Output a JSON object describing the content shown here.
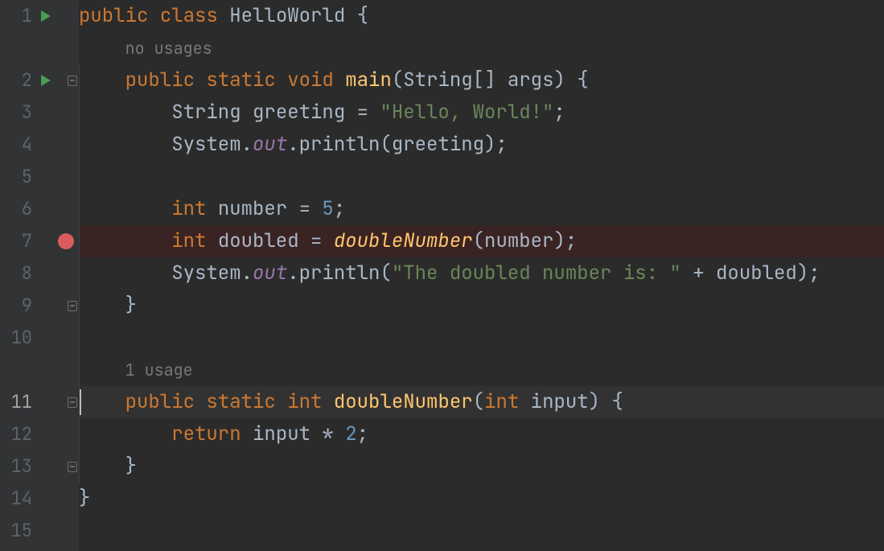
{
  "lines": [
    {
      "num": "1",
      "run": true
    },
    {
      "num": "",
      "inlay": "no usages"
    },
    {
      "num": "2",
      "run": true,
      "foldStart": true
    },
    {
      "num": "3"
    },
    {
      "num": "4"
    },
    {
      "num": "5"
    },
    {
      "num": "6"
    },
    {
      "num": "7",
      "breakpoint": true
    },
    {
      "num": "8"
    },
    {
      "num": "9",
      "foldEnd": true
    },
    {
      "num": "10"
    },
    {
      "num": "",
      "inlay": "1 usage"
    },
    {
      "num": "11",
      "foldStart": true,
      "caretLine": true
    },
    {
      "num": "12"
    },
    {
      "num": "13",
      "foldEnd": true
    },
    {
      "num": "14"
    },
    {
      "num": "15"
    }
  ],
  "inlays": {
    "noUsages": "no usages",
    "oneUsage": "1 usage"
  },
  "code": {
    "kw_public": "public",
    "kw_class": "class",
    "className": "HelloWorld",
    "kw_static": "static",
    "kw_void": "void",
    "mainName": "main",
    "stringArr": "String[]",
    "argsName": "args",
    "stringType": "String",
    "greetingVar": "greeting",
    "helloStr": "\"Hello, World!\"",
    "systemOutPrefix": "System.",
    "outField": "out",
    "printlnName": ".println",
    "kw_int": "int",
    "numberVar": "number",
    "five": "5",
    "doubledVar": "doubled",
    "doubleNumberCall": "doubleNumber",
    "doubledStr": "\"The doubled number is: \"",
    "plus": " + ",
    "doubleNumberDef": "doubleNumber",
    "inputParam": "input",
    "kw_return": "return",
    "two": "2"
  }
}
